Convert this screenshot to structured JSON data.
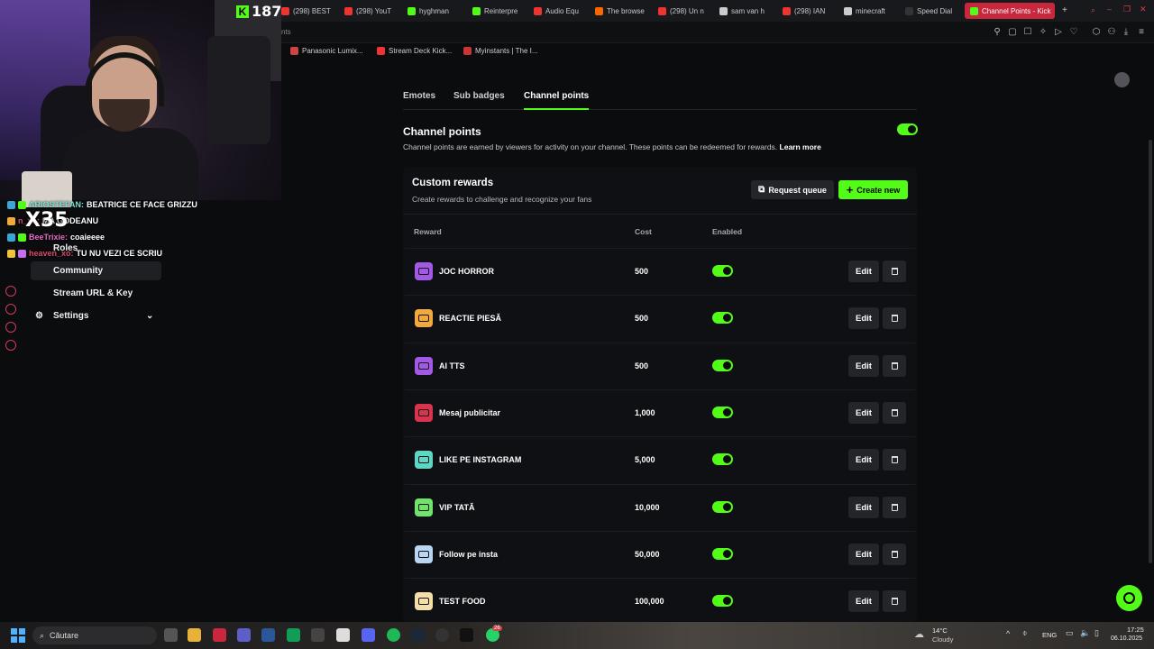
{
  "browser": {
    "tabs": [
      {
        "label": "(298) BEST",
        "color": "#e33"
      },
      {
        "label": "(298) YouT",
        "color": "#e33"
      },
      {
        "label": "hyghman",
        "color": "#53fc18"
      },
      {
        "label": "Reinterpre",
        "color": "#53fc18"
      },
      {
        "label": "Audio Equ",
        "color": "#e33"
      },
      {
        "label": "The browse",
        "color": "#f60"
      },
      {
        "label": "(298) Un n",
        "color": "#e33"
      },
      {
        "label": "sam van h",
        "color": "#ccc"
      },
      {
        "label": "(298) IAN",
        "color": "#e33"
      },
      {
        "label": "minecraft",
        "color": "#ccc"
      },
      {
        "label": "Speed Dial",
        "color": "#333"
      },
      {
        "label": "Channel Points - Kick",
        "color": "#53fc18"
      }
    ],
    "bookmarks": [
      {
        "label": "Panasonic Lumix...",
        "color": "#c44"
      },
      {
        "label": "Stream Deck Kick...",
        "color": "#e33"
      },
      {
        "label": "Myinstants | The I...",
        "color": "#c33"
      }
    ],
    "address_fragment": "nts"
  },
  "stream_overlay": {
    "viewer_count": "187",
    "chat": [
      {
        "user": "ARIOSTEFAN:",
        "message": "BEATRICE CE FACE GRIZZU",
        "user_color": "#7ee0d2"
      },
      {
        "user": "n_xo:",
        "message": "MA GODEANU",
        "user_color": "#d94b6a"
      },
      {
        "user": "BeeTrixie:",
        "message": "coaieeee",
        "user_color": "#e66cc4"
      },
      {
        "user": "heaven_xo:",
        "message": "TU NU VEZI CE SCRIU",
        "user_color": "#d94b6a"
      }
    ],
    "emote_text": "X35"
  },
  "sidebar": {
    "items": [
      {
        "label": "Roles"
      },
      {
        "label": "Community"
      },
      {
        "label": "Stream URL & Key"
      },
      {
        "label": "Settings"
      }
    ]
  },
  "subtabs": [
    {
      "label": "Emotes"
    },
    {
      "label": "Sub badges"
    },
    {
      "label": "Channel points"
    }
  ],
  "channel_points": {
    "title": "Channel points",
    "description": "Channel points are earned by viewers for activity on your channel. These points can be redeemed for rewards.",
    "learn_more": "Learn more",
    "enabled": true
  },
  "custom_rewards": {
    "title": "Custom rewards",
    "description": "Create rewards to challenge and recognize your fans",
    "request_queue_label": "Request queue",
    "create_new_label": "Create new",
    "columns": [
      "Reward",
      "Cost",
      "Enabled"
    ],
    "rows": [
      {
        "name": "JOC HORROR",
        "cost": "500",
        "enabled": true,
        "icon_color": "#a259e6"
      },
      {
        "name": "REACTIE PIESĂ",
        "cost": "500",
        "enabled": true,
        "icon_color": "#f0a93a"
      },
      {
        "name": "AI TTS",
        "cost": "500",
        "enabled": true,
        "icon_color": "#a259e6"
      },
      {
        "name": "Mesaj publicitar",
        "cost": "1,000",
        "enabled": true,
        "icon_color": "#d8344f"
      },
      {
        "name": "LIKE PE INSTAGRAM",
        "cost": "5,000",
        "enabled": true,
        "icon_color": "#5fd6c4"
      },
      {
        "name": "VIP TATĂ",
        "cost": "10,000",
        "enabled": true,
        "icon_color": "#6fe36a"
      },
      {
        "name": "Follow pe insta",
        "cost": "50,000",
        "enabled": true,
        "icon_color": "#b9d7f2"
      },
      {
        "name": "TEST FOOD",
        "cost": "100,000",
        "enabled": true,
        "icon_color": "#f4dfa8"
      }
    ],
    "edit_label": "Edit"
  },
  "taskbar": {
    "search_placeholder": "Căutare",
    "weather_temp": "14°C",
    "weather_desc": "Cloudy",
    "language": "ENG",
    "time": "17:25",
    "date": "06.10.2025",
    "notification_badge": "26"
  }
}
